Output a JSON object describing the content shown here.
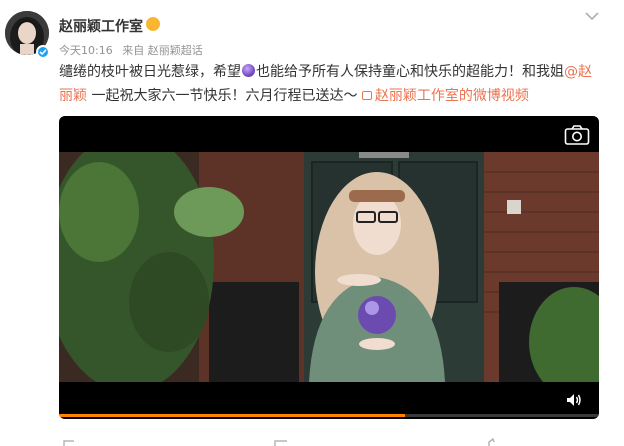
{
  "post": {
    "username": "赵丽颖工作室",
    "time": "今天10:16",
    "source": "来自 赵丽颖超话",
    "text_part1": "缱绻的枝叶被日光惹绿，希望",
    "text_part2": "也能给予所有人保持童心和快乐的超能力！和我姐",
    "mention": "@赵丽颖",
    "text_part3": " 一起祝大家六一节快乐！六月行程已送达～ ",
    "video_link": "赵丽颖工作室的微博视频"
  },
  "video": {
    "progress_percent": 64
  },
  "colors": {
    "link": "#eb7350",
    "progress": "#ff8200",
    "verified": "#1da1f2"
  },
  "icons": [
    "chevron-down-icon",
    "verified-icon",
    "camera-icon",
    "volume-icon",
    "video-link-icon",
    "crystal-ball-emoji"
  ]
}
